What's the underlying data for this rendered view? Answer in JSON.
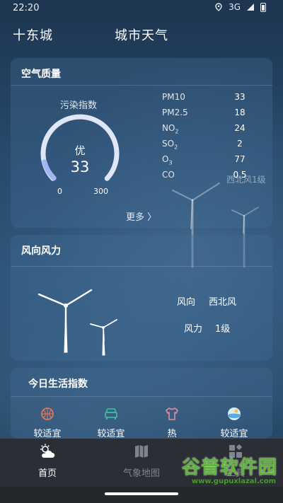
{
  "status_bar": {
    "time": "22:20",
    "network": "3G"
  },
  "header": {
    "city": "十东城",
    "title": "城市天气"
  },
  "air_quality": {
    "title": "空气质量",
    "index_label": "污染指数",
    "level": "优",
    "value": "33",
    "gauge_min": "0",
    "gauge_max": "300",
    "gauge_fraction": 0.11,
    "pollutants": [
      {
        "name": "PM10",
        "sub": "",
        "value": "33"
      },
      {
        "name": "PM2.5",
        "sub": "",
        "value": "18"
      },
      {
        "name": "NO",
        "sub": "2",
        "value": "24"
      },
      {
        "name": "SO",
        "sub": "2",
        "value": "2"
      },
      {
        "name": "O",
        "sub": "3",
        "value": "77"
      },
      {
        "name": "CO",
        "sub": "",
        "value": "0.5"
      }
    ],
    "more": "更多 〉",
    "overlay_text": "西北风1级"
  },
  "wind": {
    "title": "风向风力",
    "direction_label": "风向",
    "direction_value": "西北风",
    "force_label": "风力",
    "force_value": "1级"
  },
  "life_index": {
    "title": "今日生活指数",
    "items": [
      {
        "icon": "basketball-icon",
        "label": "较适宜",
        "color": "#e0745a"
      },
      {
        "icon": "car-icon",
        "label": "较适宜",
        "color": "#3ec4a0"
      },
      {
        "icon": "shirt-icon",
        "label": "热",
        "color": "#e88a9a"
      },
      {
        "icon": "beach-icon",
        "label": "较适宜",
        "color": "#5aa8e0"
      }
    ]
  },
  "tabbar": {
    "tabs": [
      {
        "icon": "weather-icon",
        "label": "首页",
        "active": true
      },
      {
        "icon": "map-icon",
        "label": "气象地图",
        "active": false
      },
      {
        "icon": "apps-icon",
        "label": "工具",
        "active": false
      }
    ]
  },
  "watermark": {
    "brand": "谷普软件园",
    "url": "www.gupuxlazal.com"
  }
}
